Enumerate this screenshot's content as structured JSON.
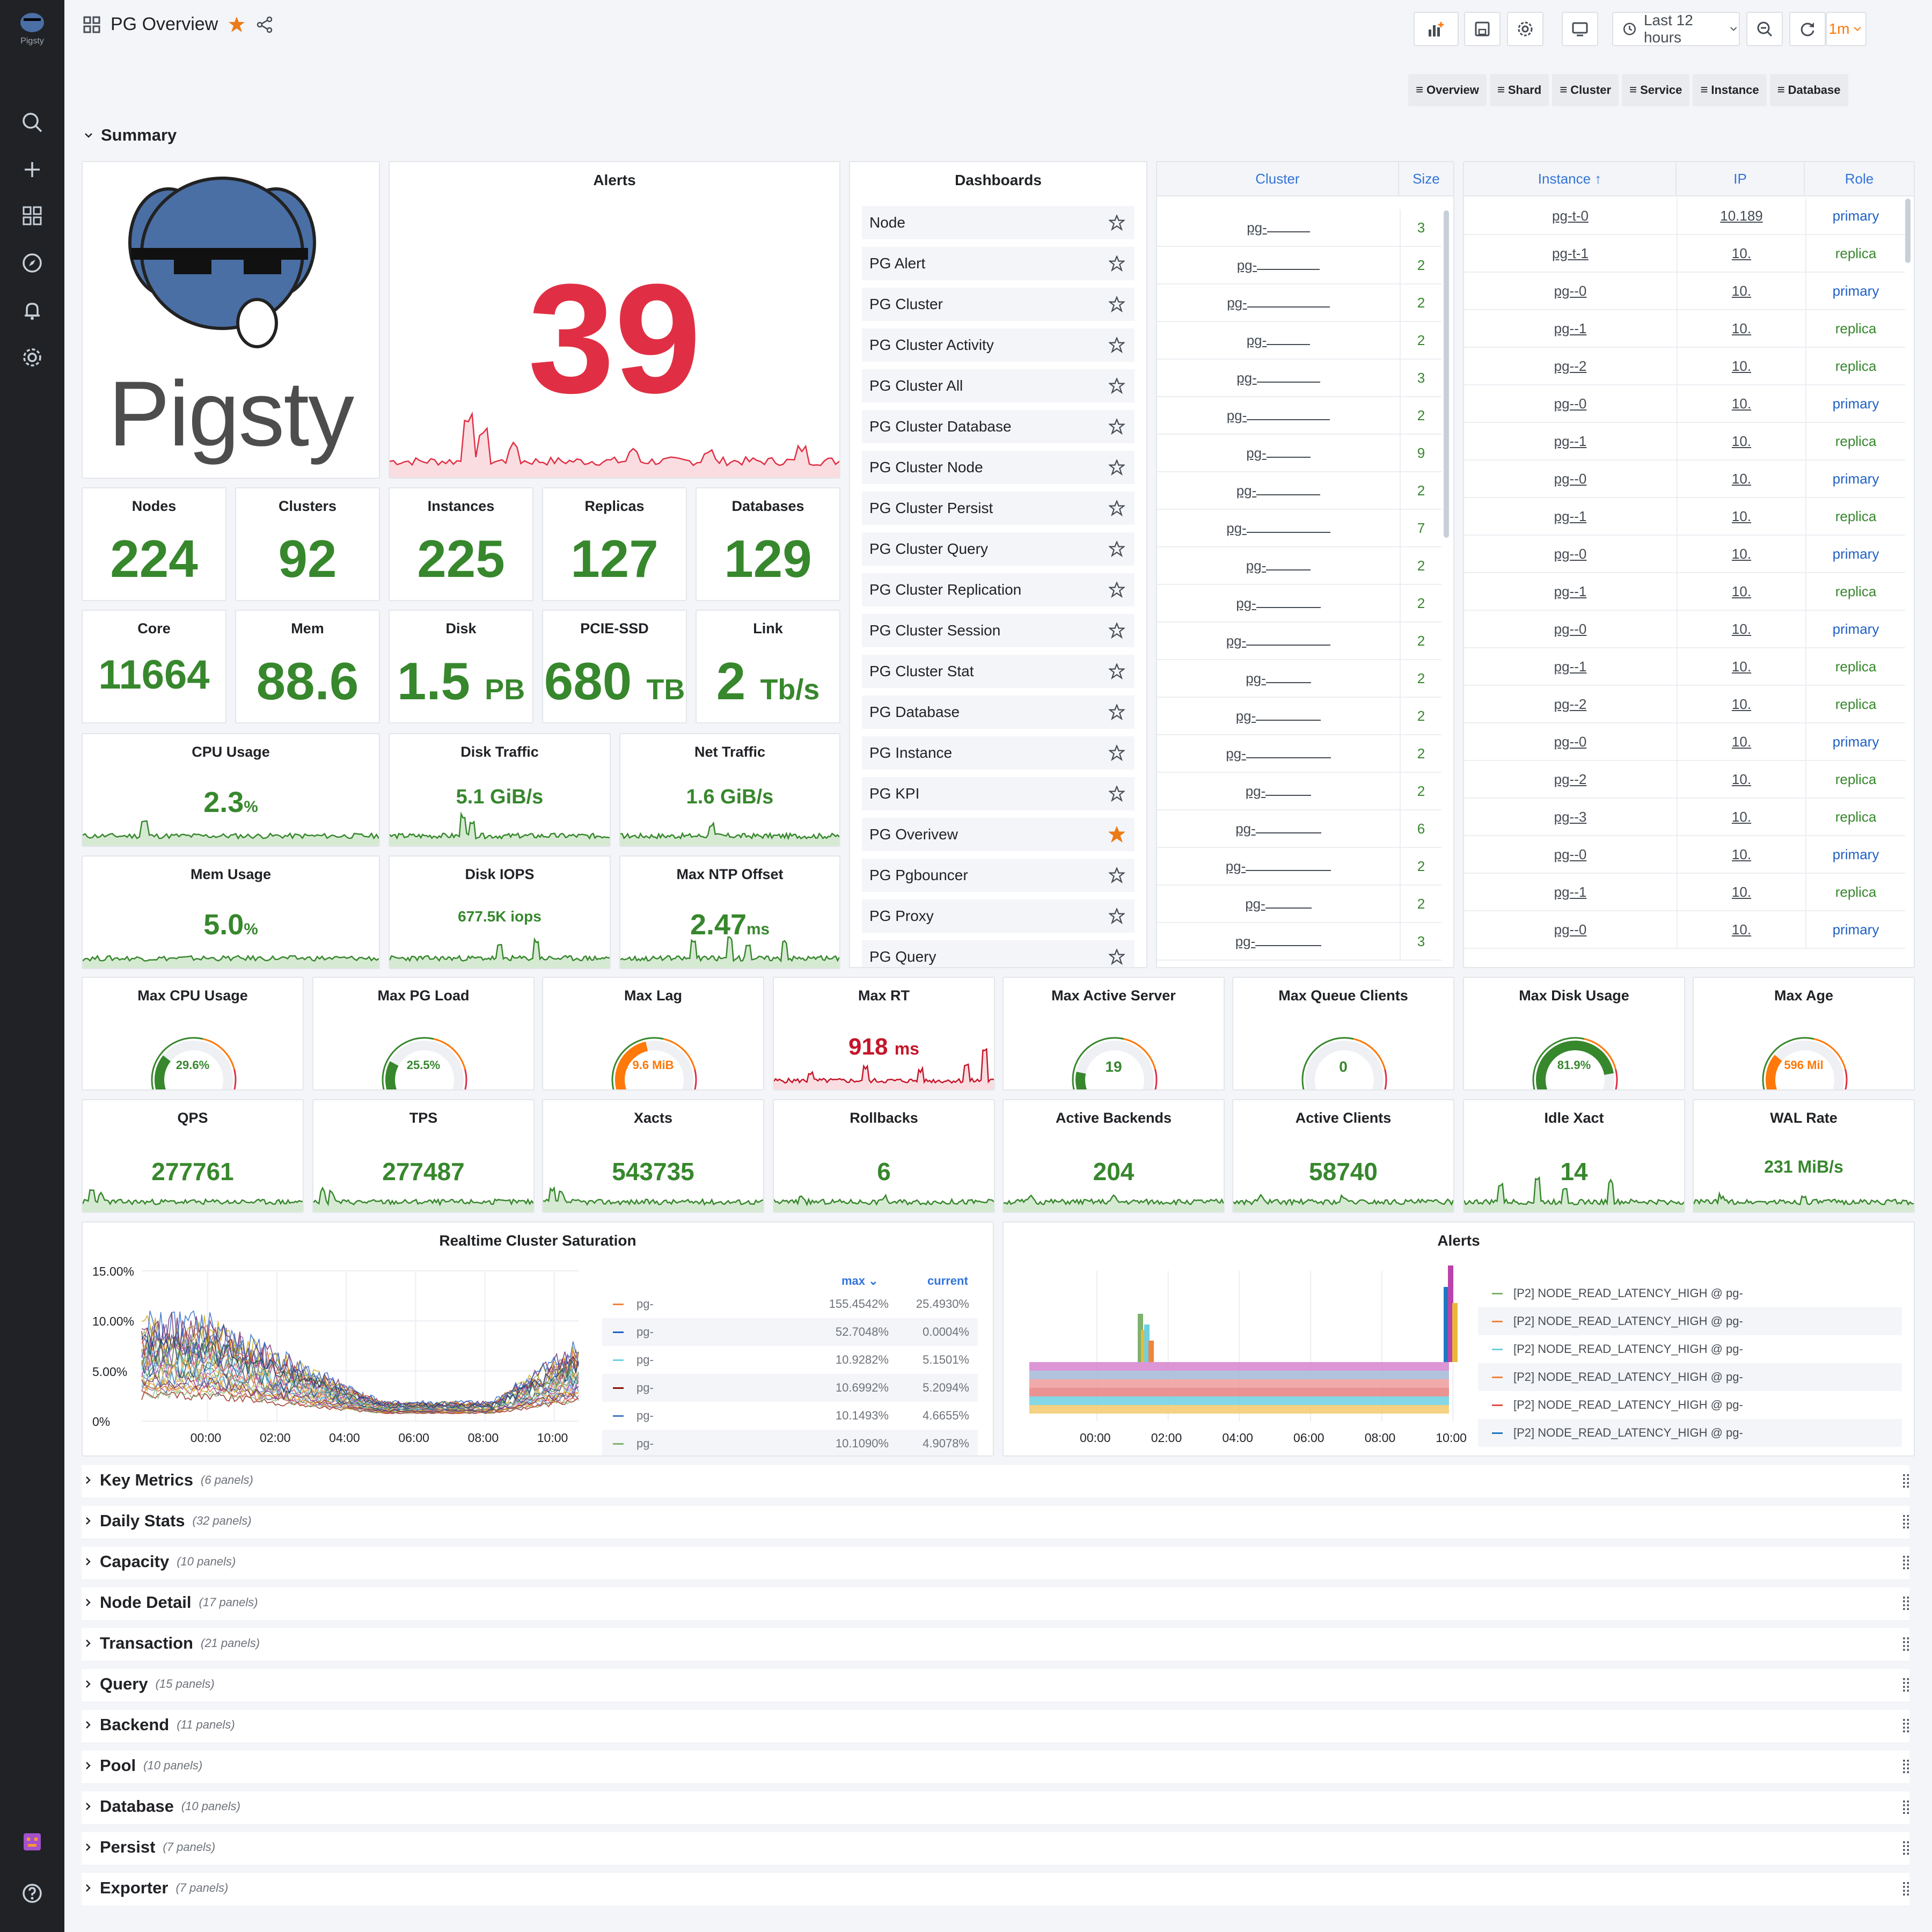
{
  "header": {
    "title": "PG Overview",
    "time_range": "Last 12 hours",
    "refresh": "1m"
  },
  "nav_links": [
    "Overview",
    "Shard",
    "Cluster",
    "Service",
    "Instance",
    "Database"
  ],
  "summary_row": "Summary",
  "logo_text": "Pigsty",
  "sidebar_logo_text": "Pigsty",
  "alerts_panel": {
    "title": "Alerts",
    "value": "39"
  },
  "stats": [
    {
      "title": "Nodes",
      "value": "224",
      "unit": ""
    },
    {
      "title": "Clusters",
      "value": "92",
      "unit": ""
    },
    {
      "title": "Instances",
      "value": "225",
      "unit": ""
    },
    {
      "title": "Replicas",
      "value": "127",
      "unit": ""
    },
    {
      "title": "Databases",
      "value": "129",
      "unit": ""
    },
    {
      "title": "Core",
      "value": "11664",
      "unit": ""
    },
    {
      "title": "Mem",
      "value": "88.6",
      "unit": "TB"
    },
    {
      "title": "Disk",
      "value": "1.5",
      "unit": "PB"
    },
    {
      "title": "PCIE-SSD",
      "value": "680",
      "unit": "TB"
    },
    {
      "title": "Link",
      "value": "2",
      "unit": "Tb/s"
    }
  ],
  "sparks": [
    {
      "title": "CPU Usage",
      "value": "2.3",
      "unit": "%"
    },
    {
      "title": "Disk Traffic",
      "value": "5.1 GiB/s",
      "unit": ""
    },
    {
      "title": "Net Traffic",
      "value": "1.6 GiB/s",
      "unit": ""
    },
    {
      "title": "Mem Usage",
      "value": "5.0",
      "unit": "%"
    },
    {
      "title": "Disk IOPS",
      "value": "677.5K iops",
      "unit": ""
    },
    {
      "title": "Max NTP Offset",
      "value": "2.47",
      "unit": "ms"
    }
  ],
  "dashboards": {
    "title": "Dashboards",
    "items": [
      "Node",
      "PG Alert",
      "PG Cluster",
      "PG Cluster Activity",
      "PG Cluster All",
      "PG Cluster Database",
      "PG Cluster Node",
      "PG Cluster Persist",
      "PG Cluster Query",
      "PG Cluster Replication",
      "PG Cluster Session",
      "PG Cluster Stat",
      "PG Database",
      "PG Instance",
      "PG KPI",
      "PG Overivew",
      "PG Pgbouncer",
      "PG Proxy",
      "PG Query"
    ],
    "starred": "PG Overivew"
  },
  "cluster_table": {
    "headers": [
      "Cluster",
      "Size"
    ],
    "rows": [
      [
        "pg-",
        "3"
      ],
      [
        "pg-",
        "2"
      ],
      [
        "pg-",
        "2"
      ],
      [
        "pg-",
        "2"
      ],
      [
        "pg-",
        "3"
      ],
      [
        "pg-",
        "2"
      ],
      [
        "pg-",
        "9"
      ],
      [
        "pg-",
        "2"
      ],
      [
        "pg-",
        "7"
      ],
      [
        "pg-",
        "2"
      ],
      [
        "pg-",
        "2"
      ],
      [
        "pg-",
        "2"
      ],
      [
        "pg-",
        "2"
      ],
      [
        "pg-",
        "2"
      ],
      [
        "pg-",
        "2"
      ],
      [
        "pg-",
        "2"
      ],
      [
        "pg-",
        "6"
      ],
      [
        "pg-",
        "2"
      ],
      [
        "pg-",
        "2"
      ],
      [
        "pg-",
        "3"
      ]
    ]
  },
  "instance_table": {
    "headers": [
      "Instance ↑",
      "IP",
      "Role"
    ],
    "rows": [
      [
        "pg-t-0",
        "10.189",
        "primary"
      ],
      [
        "pg-t-1",
        "10.",
        "replica"
      ],
      [
        "pg--0",
        "10.",
        "primary"
      ],
      [
        "pg--1",
        "10.",
        "replica"
      ],
      [
        "pg--2",
        "10.",
        "replica"
      ],
      [
        "pg--0",
        "10.",
        "primary"
      ],
      [
        "pg--1",
        "10.",
        "replica"
      ],
      [
        "pg--0",
        "10.",
        "primary"
      ],
      [
        "pg--1",
        "10.",
        "replica"
      ],
      [
        "pg--0",
        "10.",
        "primary"
      ],
      [
        "pg--1",
        "10.",
        "replica"
      ],
      [
        "pg--0",
        "10.",
        "primary"
      ],
      [
        "pg--1",
        "10.",
        "replica"
      ],
      [
        "pg--2",
        "10.",
        "replica"
      ],
      [
        "pg--0",
        "10.",
        "primary"
      ],
      [
        "pg--2",
        "10.",
        "replica"
      ],
      [
        "pg--3",
        "10.",
        "replica"
      ],
      [
        "pg--0",
        "10.",
        "primary"
      ],
      [
        "pg--1",
        "10.",
        "replica"
      ],
      [
        "pg--0",
        "10.",
        "primary"
      ]
    ]
  },
  "gauges": [
    {
      "title": "Max CPU Usage",
      "value": "29.6%",
      "fraction": 0.296,
      "color": "#37872d"
    },
    {
      "title": "Max PG Load",
      "value": "25.5%",
      "fraction": 0.255,
      "color": "#37872d"
    },
    {
      "title": "Max Lag",
      "value": "9.6 MiB",
      "fraction": 0.45,
      "color": "#ff780a"
    },
    {
      "title": "Max Active Server",
      "value": "19",
      "fraction": 0.19,
      "color": "#37872d"
    },
    {
      "title": "Max Queue Clients",
      "value": "0",
      "fraction": 0.0,
      "color": "#37872d"
    },
    {
      "title": "Max Disk Usage",
      "value": "81.9%",
      "fraction": 0.819,
      "color": "#37872d"
    },
    {
      "title": "Max Age",
      "value": "596 Mil",
      "fraction": 0.3,
      "color": "#ff780a"
    }
  ],
  "max_rt": {
    "title": "Max RT",
    "value": "918",
    "unit": "ms"
  },
  "kpis": [
    {
      "title": "QPS",
      "value": "277761"
    },
    {
      "title": "TPS",
      "value": "277487"
    },
    {
      "title": "Xacts",
      "value": "543735"
    },
    {
      "title": "Rollbacks",
      "value": "6"
    },
    {
      "title": "Active Backends",
      "value": "204"
    },
    {
      "title": "Active Clients",
      "value": "58740"
    },
    {
      "title": "Idle Xact",
      "value": "14"
    },
    {
      "title": "WAL Rate",
      "value": "231 MiB/s"
    }
  ],
  "saturation": {
    "title": "Realtime Cluster Saturation",
    "legend_headers": [
      "max ⌄",
      "current"
    ],
    "legend": [
      [
        "pg-",
        "155.4542%",
        "25.4930%",
        "#ef843c"
      ],
      [
        "pg-",
        "52.7048%",
        "0.0004%",
        "#1f60c4"
      ],
      [
        "pg-",
        "10.9282%",
        "5.1501%",
        "#6ed0e0"
      ],
      [
        "pg-",
        "10.6992%",
        "5.2094%",
        "#890f02"
      ],
      [
        "pg-",
        "10.1493%",
        "4.6655%",
        "#447ebc"
      ],
      [
        "pg-",
        "10.1090%",
        "4.9078%",
        "#7eb26d"
      ]
    ]
  },
  "alerts_chart": {
    "title": "Alerts",
    "legend": [
      [
        "[P2] NODE_READ_LATENCY_HIGH @ pg-",
        "#7eb26d"
      ],
      [
        "[P2] NODE_READ_LATENCY_HIGH @ pg-",
        "#ef843c"
      ],
      [
        "[P2] NODE_READ_LATENCY_HIGH @ pg-",
        "#6ed0e0"
      ],
      [
        "[P2] NODE_READ_LATENCY_HIGH @ pg-",
        "#ef843c"
      ],
      [
        "[P2] NODE_READ_LATENCY_HIGH @ pg-",
        "#e24d42"
      ],
      [
        "[P2] NODE_READ_LATENCY_HIGH @ pg-",
        "#1f78c1"
      ]
    ]
  },
  "chart_data": [
    {
      "type": "line",
      "title": "Realtime Cluster Saturation",
      "x": [
        "00:00",
        "02:00",
        "04:00",
        "06:00",
        "08:00",
        "10:00"
      ],
      "ylim": [
        0,
        15
      ],
      "y_ticks": [
        "15.00%",
        "10.00%",
        "5.00%",
        "0%"
      ],
      "series": []
    },
    {
      "type": "bar",
      "title": "Alerts",
      "x": [
        "00:00",
        "02:00",
        "04:00",
        "06:00",
        "08:00",
        "10:00"
      ]
    }
  ],
  "rows": [
    {
      "title": "Key Metrics",
      "count": "(6 panels)"
    },
    {
      "title": "Daily Stats",
      "count": "(32 panels)"
    },
    {
      "title": "Capacity",
      "count": "(10 panels)"
    },
    {
      "title": "Node Detail",
      "count": "(17 panels)"
    },
    {
      "title": "Transaction",
      "count": "(21 panels)"
    },
    {
      "title": "Query",
      "count": "(15 panels)"
    },
    {
      "title": "Backend",
      "count": "(11 panels)"
    },
    {
      "title": "Pool",
      "count": "(10 panels)"
    },
    {
      "title": "Database",
      "count": "(10 panels)"
    },
    {
      "title": "Persist",
      "count": "(7 panels)"
    },
    {
      "title": "Exporter",
      "count": "(7 panels)"
    }
  ],
  "colors": {
    "green": "#37872d",
    "red": "#e02f44",
    "orange": "#ff780a",
    "blue": "#3274d9"
  }
}
